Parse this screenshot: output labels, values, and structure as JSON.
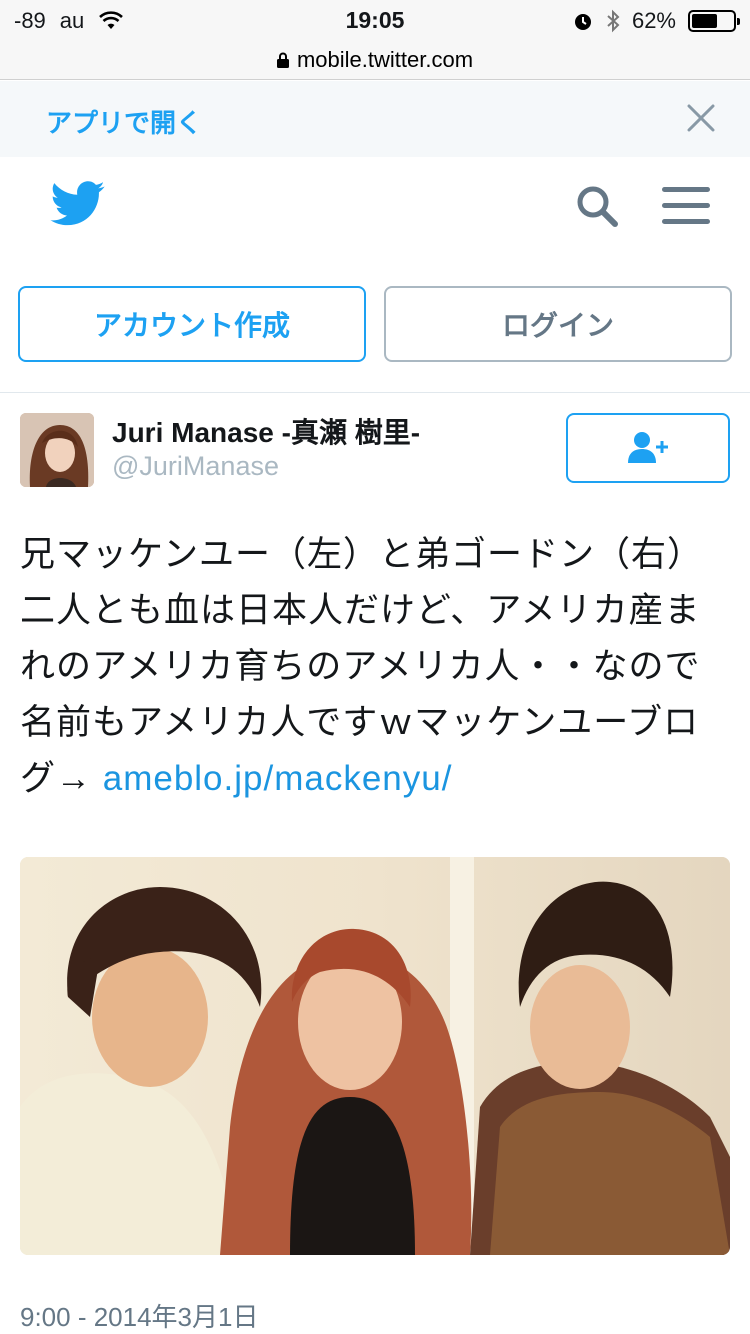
{
  "status_bar": {
    "signal": "-89",
    "carrier": "au",
    "time": "19:05",
    "battery_percent": "62%",
    "battery_level": 0.62
  },
  "url_bar": {
    "domain": "mobile.twitter.com"
  },
  "app_banner": {
    "open_in_app": "アプリで開く"
  },
  "auth": {
    "signup_label": "アカウント作成",
    "login_label": "ログイン"
  },
  "tweet": {
    "author_name": "Juri Manase -真瀬 樹里-",
    "author_handle": "@JuriManase",
    "text": "兄マッケンユー（左）と弟ゴードン（右）二人とも血は日本人だけど、アメリカ産まれのアメリカ育ちのアメリカ人・・なので名前もアメリカ人ですｗマッケンユーブログ→ ",
    "link_text": "ameblo.jp/mackenyu/",
    "timestamp": "9:00 - 2014年3月1日"
  },
  "colors": {
    "accent": "#1da1f2",
    "link": "#1b95e0",
    "muted": "#657786",
    "handle": "#aab8c2",
    "banner_bg": "#f5f8fa"
  },
  "icons": {
    "logo": "twitter-bird-icon",
    "search": "search-icon",
    "menu": "hamburger-menu-icon",
    "close": "close-icon",
    "follow": "follow-user-icon",
    "lock": "lock-icon",
    "wifi": "wifi-icon",
    "alarm": "alarm-icon",
    "bluetooth": "bluetooth-icon",
    "battery": "battery-icon"
  }
}
